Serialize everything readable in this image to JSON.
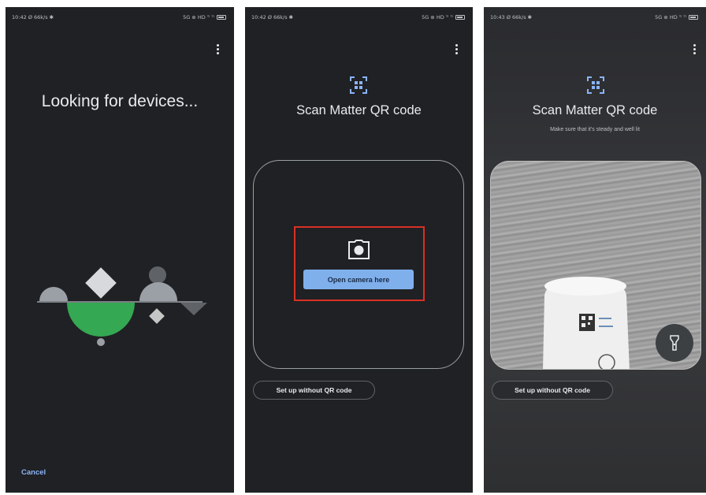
{
  "screens": [
    {
      "status": {
        "time": "10:42",
        "left_extra": "Ø 66k/s ✱",
        "right": "5G ⊛ HD ᵀˡ ᵀˡ"
      },
      "title": "Looking for devices...",
      "cancel_label": "Cancel",
      "icons": [
        "more-vert-icon",
        "searching-shapes-illustration"
      ]
    },
    {
      "status": {
        "time": "10:42",
        "left_extra": "Ø 66k/s ✱",
        "right": "5G ⊛ HD ᵀˡ ᵀˡ"
      },
      "title": "Scan Matter QR code",
      "open_camera_label": "Open camera here",
      "setup_without_qr_label": "Set up without QR code",
      "icons": [
        "more-vert-icon",
        "qr-scan-icon",
        "camera-icon"
      ]
    },
    {
      "status": {
        "time": "10:43",
        "left_extra": "Ø 66k/s ✱",
        "right": "5G ⊛ HD ᵀˡ ᵀˡ"
      },
      "title": "Scan Matter QR code",
      "subtitle": "Make sure that it's steady and well lit",
      "setup_without_qr_label": "Set up without QR code",
      "icons": [
        "more-vert-icon",
        "qr-scan-icon",
        "flashlight-icon"
      ]
    }
  ],
  "colors": {
    "background": "#202124",
    "accent_blue": "#8ab4f8",
    "button_blue": "#7fb0ec",
    "green_shape": "#34a853",
    "highlight_red": "#d93025"
  }
}
